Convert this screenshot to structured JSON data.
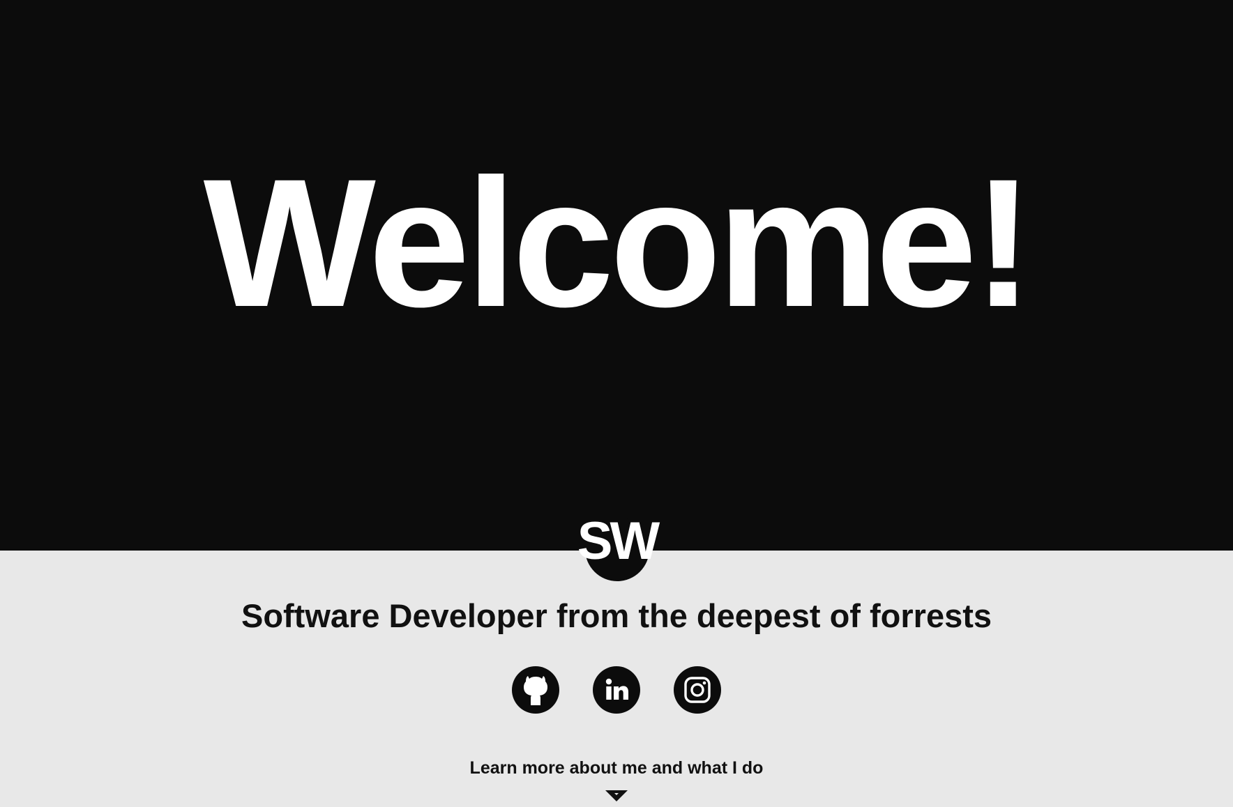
{
  "hero": {
    "title": "Welcome!"
  },
  "logo": {
    "text": "SW"
  },
  "tagline": "Software Developer from the deepest of forrests",
  "socials": [
    {
      "name": "github",
      "icon": "github-icon"
    },
    {
      "name": "linkedin",
      "icon": "linkedin-icon"
    },
    {
      "name": "instagram",
      "icon": "instagram-icon"
    }
  ],
  "learn_more": {
    "label": "Learn more about me and what I do",
    "icon": "chevron-down-icon"
  },
  "colors": {
    "hero_background": "#0c0c0c",
    "page_background": "#e8e8e8",
    "text_light": "#ffffff",
    "text_dark": "#111111"
  }
}
